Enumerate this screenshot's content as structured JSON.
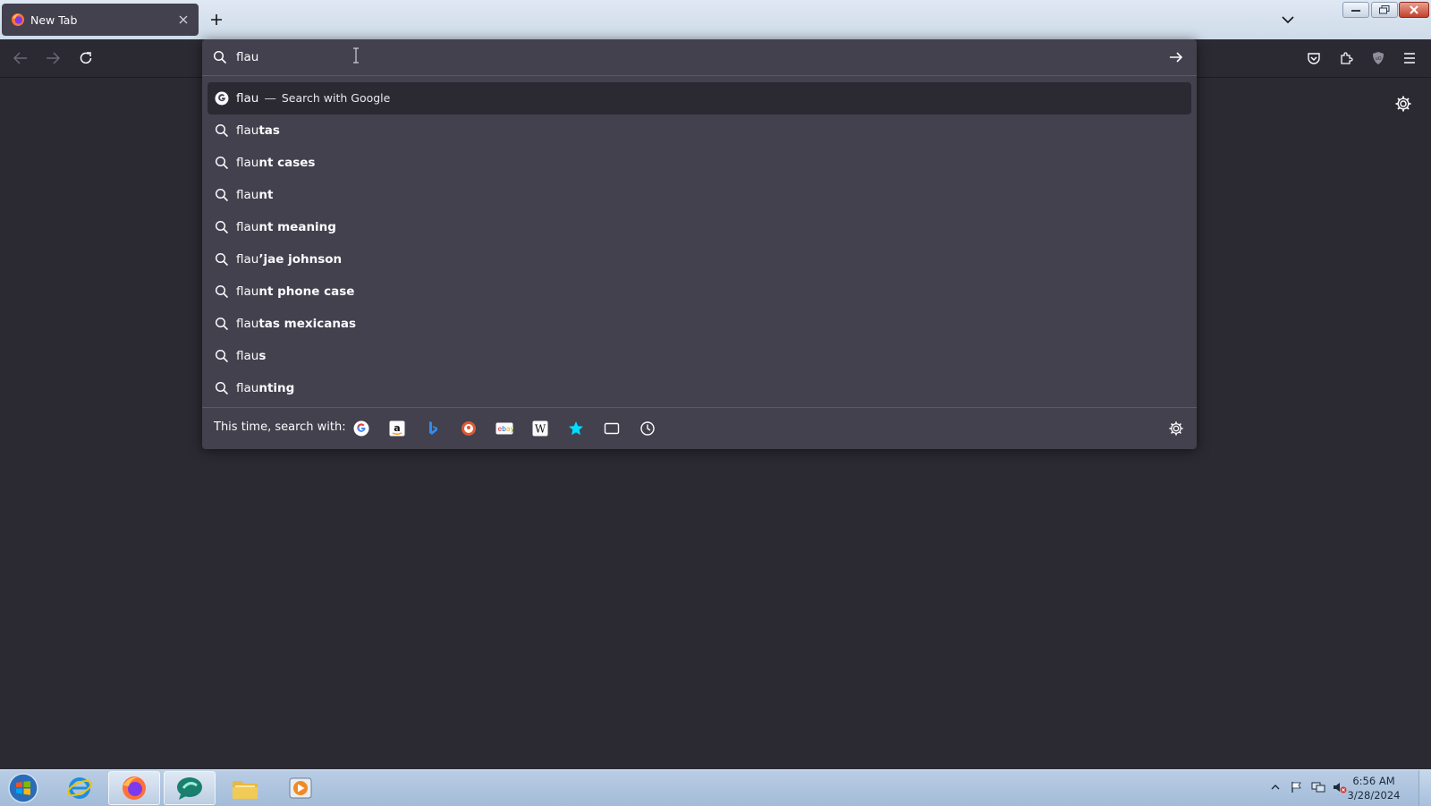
{
  "browser": {
    "tab_title": "New Tab"
  },
  "urlbar": {
    "value": "flau"
  },
  "results": [
    {
      "typed": "flau",
      "rest": "",
      "action": "Search with Google",
      "separator": "—",
      "icon": "google-icon"
    },
    {
      "typed": "flau",
      "rest": "tas",
      "icon": "search-icon"
    },
    {
      "typed": "flau",
      "rest": "nt cases",
      "icon": "search-icon"
    },
    {
      "typed": "flau",
      "rest": "nt",
      "icon": "search-icon"
    },
    {
      "typed": "flau",
      "rest": "nt meaning",
      "icon": "search-icon"
    },
    {
      "typed": "flau",
      "rest": "’jae johnson",
      "icon": "search-icon"
    },
    {
      "typed": "flau",
      "rest": "nt phone case",
      "icon": "search-icon"
    },
    {
      "typed": "flau",
      "rest": "tas mexicanas",
      "icon": "search-icon"
    },
    {
      "typed": "flau",
      "rest": "s",
      "icon": "search-icon"
    },
    {
      "typed": "flau",
      "rest": "nting",
      "icon": "search-icon"
    }
  ],
  "oneoff": {
    "label": "This time, search with:",
    "engines": [
      "Google",
      "Amazon",
      "Bing",
      "DuckDuckGo",
      "eBay",
      "Wikipedia",
      "Bookmarks",
      "Tabs",
      "History"
    ]
  },
  "taskbar": {
    "time": "6:56 AM",
    "date": "3/28/2024"
  },
  "colors": {
    "page_bg": "#2b2a33",
    "popup_bg": "#42414d",
    "text": "#fbfbfe",
    "taskbar": "#a3bcd9"
  }
}
